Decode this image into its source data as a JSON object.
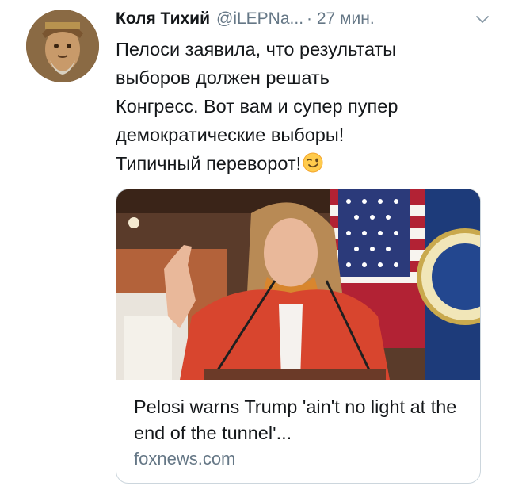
{
  "tweet": {
    "author_name": "Коля Тихий",
    "author_handle": "@iLEPNa...",
    "timestamp": "· 27 мин.",
    "text": "Пелоси заявила, что результаты\nвыборов должен решать\nКонгресс.  Вот вам и супер пупер\nдемократические выборы!\nТипичный переворот!",
    "emoji": "winking-face"
  },
  "card": {
    "title": "Pelosi warns Trump 'ain't no light at the end of the tunnel'...",
    "domain": "foxnews.com"
  },
  "colors": {
    "text_primary": "#14171a",
    "text_secondary": "#657786",
    "border": "#ccd6dd",
    "jacket": "#d8452e"
  }
}
